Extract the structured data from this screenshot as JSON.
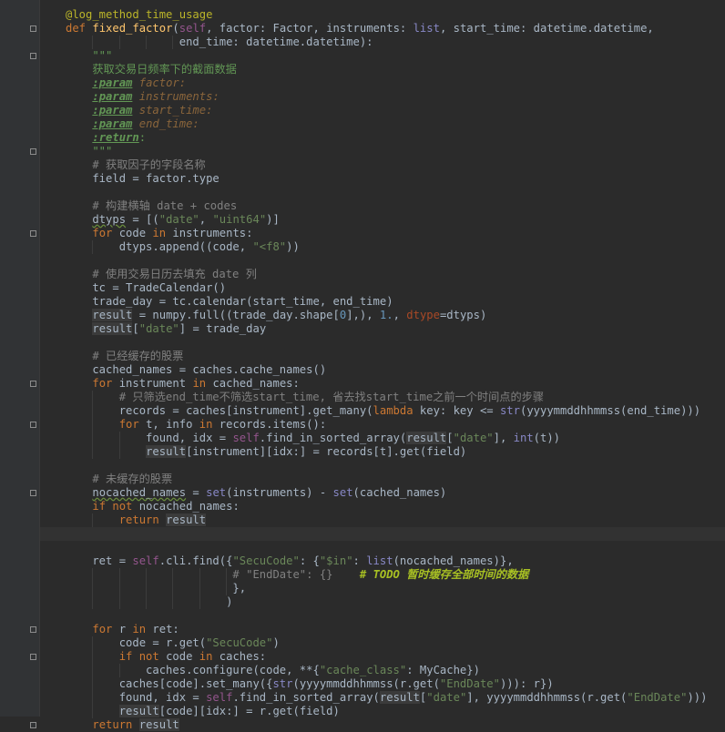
{
  "editor": {
    "language": "python",
    "current_line": 38,
    "lines": [
      [
        {
          "t": "@log_method_time_usage",
          "c": "dec"
        }
      ],
      [
        {
          "t": "def ",
          "c": "kw"
        },
        {
          "t": "fixed_factor",
          "c": "fn"
        },
        {
          "t": "(",
          "c": "plain"
        },
        {
          "t": "self",
          "c": "self"
        },
        {
          "t": ", factor: Factor, instruments: ",
          "c": "plain"
        },
        {
          "t": "list",
          "c": "bi"
        },
        {
          "t": ", start_time: datetime.datetime,",
          "c": "plain"
        }
      ],
      [
        {
          "t": "                 end_time: datetime.datetime):",
          "c": "plain"
        }
      ],
      [
        {
          "t": "    \"\"\"",
          "c": "doc"
        }
      ],
      [
        {
          "t": "    获取交易日频率下的截面数据",
          "c": "doc"
        }
      ],
      [
        {
          "t": "    ",
          "c": "doc"
        },
        {
          "t": ":param",
          "c": "tag"
        },
        {
          "t": " factor:",
          "c": "docp"
        }
      ],
      [
        {
          "t": "    ",
          "c": "doc"
        },
        {
          "t": ":param",
          "c": "tag"
        },
        {
          "t": " instruments:",
          "c": "docp"
        }
      ],
      [
        {
          "t": "    ",
          "c": "doc"
        },
        {
          "t": ":param",
          "c": "tag"
        },
        {
          "t": " start_time:",
          "c": "docp"
        }
      ],
      [
        {
          "t": "    ",
          "c": "doc"
        },
        {
          "t": ":param",
          "c": "tag"
        },
        {
          "t": " end_time:",
          "c": "docp"
        }
      ],
      [
        {
          "t": "    ",
          "c": "doc"
        },
        {
          "t": ":return",
          "c": "tag"
        },
        {
          "t": ":",
          "c": "doc"
        }
      ],
      [
        {
          "t": "    \"\"\"",
          "c": "doc"
        }
      ],
      [
        {
          "t": "    # 获取因子的字段名称",
          "c": "com"
        }
      ],
      [
        {
          "t": "    field = factor.type",
          "c": "plain"
        }
      ],
      [],
      [
        {
          "t": "    # 构建横轴 date + codes",
          "c": "com"
        }
      ],
      [
        {
          "t": "    ",
          "c": "plain"
        },
        {
          "t": "dtyps",
          "c": "typo"
        },
        {
          "t": " = [(",
          "c": "plain"
        },
        {
          "t": "\"date\"",
          "c": "str"
        },
        {
          "t": ", ",
          "c": "plain"
        },
        {
          "t": "\"uint64\"",
          "c": "str"
        },
        {
          "t": ")]",
          "c": "plain"
        }
      ],
      [
        {
          "t": "    ",
          "c": "plain"
        },
        {
          "t": "for ",
          "c": "kw"
        },
        {
          "t": "code ",
          "c": "plain"
        },
        {
          "t": "in ",
          "c": "kw"
        },
        {
          "t": "instruments:",
          "c": "plain"
        }
      ],
      [
        {
          "t": "        dtyps.append((code, ",
          "c": "plain"
        },
        {
          "t": "\"<f8\"",
          "c": "str"
        },
        {
          "t": "))",
          "c": "plain"
        }
      ],
      [],
      [
        {
          "t": "    # 使用交易日历去填充 date 列",
          "c": "com"
        }
      ],
      [
        {
          "t": "    tc = TradeCalendar()",
          "c": "plain"
        }
      ],
      [
        {
          "t": "    trade_day = tc.calendar(start_time, end_time)",
          "c": "plain"
        }
      ],
      [
        {
          "t": "    ",
          "c": "plain"
        },
        {
          "t": "result",
          "c": "hl"
        },
        {
          "t": " = numpy.full((trade_day.shape[",
          "c": "plain"
        },
        {
          "t": "0",
          "c": "num"
        },
        {
          "t": "],), ",
          "c": "plain"
        },
        {
          "t": "1.",
          "c": "num"
        },
        {
          "t": ", ",
          "c": "plain"
        },
        {
          "t": "dtype",
          "c": "kwa"
        },
        {
          "t": "=dtyps)",
          "c": "plain"
        }
      ],
      [
        {
          "t": "    ",
          "c": "plain"
        },
        {
          "t": "result",
          "c": "hl"
        },
        {
          "t": "[",
          "c": "plain"
        },
        {
          "t": "\"date\"",
          "c": "str"
        },
        {
          "t": "] = trade_day",
          "c": "plain"
        }
      ],
      [],
      [
        {
          "t": "    # 已经缓存的股票",
          "c": "com"
        }
      ],
      [
        {
          "t": "    cached_names = caches.cache_names()",
          "c": "plain"
        }
      ],
      [
        {
          "t": "    ",
          "c": "plain"
        },
        {
          "t": "for ",
          "c": "kw"
        },
        {
          "t": "instrument ",
          "c": "plain"
        },
        {
          "t": "in ",
          "c": "kw"
        },
        {
          "t": "cached_names:",
          "c": "plain"
        }
      ],
      [
        {
          "t": "        # 只筛选end_time不筛选start_time, 省去找start_time之前一个时间点的步骤",
          "c": "com"
        }
      ],
      [
        {
          "t": "        records = caches[instrument].get_many(",
          "c": "plain"
        },
        {
          "t": "lambda ",
          "c": "kw"
        },
        {
          "t": "key: key <= ",
          "c": "plain"
        },
        {
          "t": "str",
          "c": "bi"
        },
        {
          "t": "(yyyymmddhhmmss(end_time)))",
          "c": "plain"
        }
      ],
      [
        {
          "t": "        ",
          "c": "plain"
        },
        {
          "t": "for ",
          "c": "kw"
        },
        {
          "t": "t, info ",
          "c": "plain"
        },
        {
          "t": "in ",
          "c": "kw"
        },
        {
          "t": "records.items():",
          "c": "plain"
        }
      ],
      [
        {
          "t": "            found, idx = ",
          "c": "plain"
        },
        {
          "t": "self",
          "c": "self"
        },
        {
          "t": ".find_in_sorted_array(",
          "c": "plain"
        },
        {
          "t": "result",
          "c": "hl"
        },
        {
          "t": "[",
          "c": "plain"
        },
        {
          "t": "\"date\"",
          "c": "str"
        },
        {
          "t": "], ",
          "c": "plain"
        },
        {
          "t": "int",
          "c": "bi"
        },
        {
          "t": "(t))",
          "c": "plain"
        }
      ],
      [
        {
          "t": "            ",
          "c": "plain"
        },
        {
          "t": "result",
          "c": "hl"
        },
        {
          "t": "[instrument][idx:] = records[t].get(field)",
          "c": "plain"
        }
      ],
      [],
      [
        {
          "t": "    # 未缓存的股票",
          "c": "com"
        }
      ],
      [
        {
          "t": "    ",
          "c": "plain"
        },
        {
          "t": "nocached_names",
          "c": "typo"
        },
        {
          "t": " = ",
          "c": "plain"
        },
        {
          "t": "set",
          "c": "bi"
        },
        {
          "t": "(instruments) - ",
          "c": "plain"
        },
        {
          "t": "set",
          "c": "bi"
        },
        {
          "t": "(cached_names)",
          "c": "plain"
        }
      ],
      [
        {
          "t": "    ",
          "c": "plain"
        },
        {
          "t": "if not ",
          "c": "kw"
        },
        {
          "t": "nocached_names:",
          "c": "plain"
        }
      ],
      [
        {
          "t": "        ",
          "c": "plain"
        },
        {
          "t": "return ",
          "c": "kw"
        },
        {
          "t": "result",
          "c": "hl"
        }
      ],
      [],
      [],
      [
        {
          "t": "    ret = ",
          "c": "plain"
        },
        {
          "t": "self",
          "c": "self"
        },
        {
          "t": ".cli.find({",
          "c": "plain"
        },
        {
          "t": "\"SecuCode\"",
          "c": "str"
        },
        {
          "t": ": {",
          "c": "plain"
        },
        {
          "t": "\"$in\"",
          "c": "str"
        },
        {
          "t": ": ",
          "c": "plain"
        },
        {
          "t": "list",
          "c": "bi"
        },
        {
          "t": "(nocached_names)},",
          "c": "plain"
        }
      ],
      [
        {
          "t": "                         # \"EndDate\": {}    ",
          "c": "com"
        },
        {
          "t": "# TODO 暂时缓存全部时间的数据",
          "c": "todo"
        }
      ],
      [
        {
          "t": "                         },",
          "c": "plain"
        }
      ],
      [
        {
          "t": "                        )",
          "c": "plain"
        }
      ],
      [],
      [
        {
          "t": "    ",
          "c": "plain"
        },
        {
          "t": "for ",
          "c": "kw"
        },
        {
          "t": "r ",
          "c": "plain"
        },
        {
          "t": "in ",
          "c": "kw"
        },
        {
          "t": "ret:",
          "c": "plain"
        }
      ],
      [
        {
          "t": "        code = r.get(",
          "c": "plain"
        },
        {
          "t": "\"SecuCode\"",
          "c": "str"
        },
        {
          "t": ")",
          "c": "plain"
        }
      ],
      [
        {
          "t": "        ",
          "c": "plain"
        },
        {
          "t": "if not ",
          "c": "kw"
        },
        {
          "t": "code ",
          "c": "plain"
        },
        {
          "t": "in ",
          "c": "kw"
        },
        {
          "t": "caches:",
          "c": "plain"
        }
      ],
      [
        {
          "t": "            caches.configure(code, **{",
          "c": "plain"
        },
        {
          "t": "\"cache_class\"",
          "c": "str"
        },
        {
          "t": ": MyCache})",
          "c": "plain"
        }
      ],
      [
        {
          "t": "        caches[code].set_many({",
          "c": "plain"
        },
        {
          "t": "str",
          "c": "bi"
        },
        {
          "t": "(yyyymmddhhmmss(r.get(",
          "c": "plain"
        },
        {
          "t": "\"EndDate\"",
          "c": "str"
        },
        {
          "t": "))): r})",
          "c": "plain"
        }
      ],
      [
        {
          "t": "        found, idx = ",
          "c": "plain"
        },
        {
          "t": "self",
          "c": "self"
        },
        {
          "t": ".find_in_sorted_array(",
          "c": "plain"
        },
        {
          "t": "result",
          "c": "hl"
        },
        {
          "t": "[",
          "c": "plain"
        },
        {
          "t": "\"date\"",
          "c": "str"
        },
        {
          "t": "], yyyymmddhhmmss(r.get(",
          "c": "plain"
        },
        {
          "t": "\"EndDate\"",
          "c": "str"
        },
        {
          "t": ")))",
          "c": "plain"
        }
      ],
      [
        {
          "t": "        ",
          "c": "plain"
        },
        {
          "t": "result",
          "c": "hl"
        },
        {
          "t": "[code][idx:] = r.get(field)",
          "c": "plain"
        }
      ],
      [
        {
          "t": "    ",
          "c": "plain"
        },
        {
          "t": "return ",
          "c": "kw"
        },
        {
          "t": "result",
          "c": "hl"
        }
      ]
    ]
  }
}
